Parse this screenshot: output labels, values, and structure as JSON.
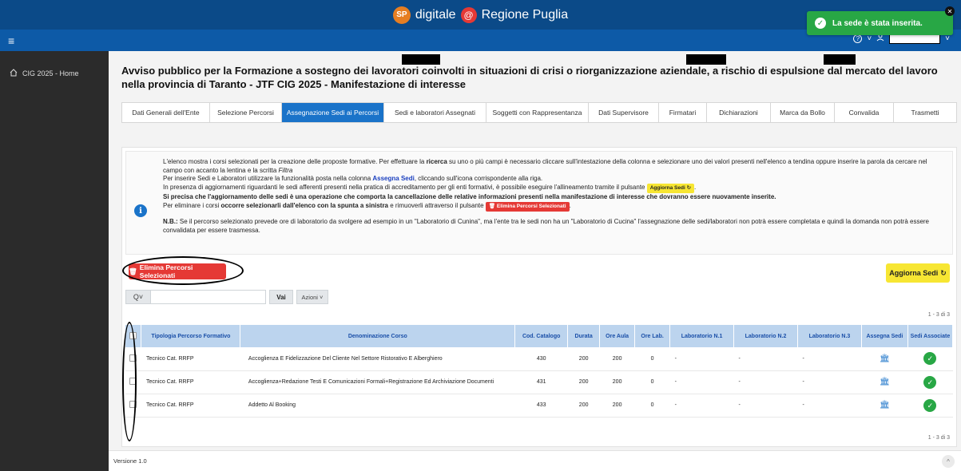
{
  "header": {
    "brand_badge": "SP",
    "brand_text_1": "digitale",
    "brand_at": "@",
    "brand_text_2": "Regione Puglia",
    "help_icon": "?",
    "chevron": "˅",
    "user_icon": "user-icon"
  },
  "toast": {
    "message": "La sede è stata inserita.",
    "check": "✓",
    "close": "✕"
  },
  "sidebar": {
    "items": [
      {
        "icon": "home-icon",
        "label": "CIG 2025 - Home"
      }
    ]
  },
  "page": {
    "title": "Avviso pubblico per la Formazione a sostegno dei lavoratori coinvolti in situazioni di crisi o riorganizzazione aziendale, a rischio di espulsione dal mercato del lavoro nella provincia di Taranto - JTF CIG 2025 - Manifestazione di interesse"
  },
  "tabs": [
    {
      "label": "Dati Generali dell'Ente",
      "active": false
    },
    {
      "label": "Selezione Percorsi",
      "active": false
    },
    {
      "label": "Assegnazione Sedi ai Percorsi",
      "active": true
    },
    {
      "label": "Sedi e laboratori Assegnati",
      "active": false
    },
    {
      "label": "Soggetti con Rappresentanza",
      "active": false
    },
    {
      "label": "Dati Supervisore",
      "active": false
    },
    {
      "label": "Firmatari",
      "active": false
    },
    {
      "label": "Dichiarazioni",
      "active": false
    },
    {
      "label": "Marca da Bollo",
      "active": false
    },
    {
      "label": "Convalida",
      "active": false
    },
    {
      "label": "Trasmetti",
      "active": false
    }
  ],
  "info": {
    "icon_letter": "i",
    "p1_a": "L'elenco mostra i corsi selezionati per la creazione delle proposte formative. Per effettuare la ",
    "p1_kw": "ricerca",
    "p1_b": " su uno o più campi è necessario cliccare sull'intestazione della colonna e selezionare uno dei valori presenti nell'elenco a tendina oppure inserire la parola da cercare nel campo con accanto la lentina e la scritta ",
    "p1_filter": "Filtra",
    "p2_a": "Per inserire Sedi e Laboratori utilizzare la funzionalità posta nella colonna ",
    "p2_kw": "Assegna Sedi",
    "p2_b": ", cliccando sull'icona corrispondente alla riga.",
    "p3_a": "In presenza di aggiornamenti riguardanti le sedi afferenti presenti nella pratica di accreditamento per gli enti formativi, è possibile eseguire l'allineamento tramite il pulsante ",
    "p3_chip": "Aggiorna Sedi ↻",
    "p3_b": ".",
    "p4": "Si precisa che l'aggiornamento delle sedi è una operazione che comporta la cancellazione delle relative informazioni presenti nella manifestazione di interesse che dovranno essere nuovamente inserite.",
    "p5_a": "Per eliminare i corsi ",
    "p5_kw": "occorre selezionarli dall'elenco con la spunta a sinistra",
    "p5_b": " e rimuoverli attraverso il pulsante ",
    "p5_chip": "🗑 Elimina Percorsi Selezionati",
    "p5_c": ".",
    "nb_label": "N.B.:",
    "nb_text": " Se il percorso selezionato prevede ore di laboratorio da svolgere ad esempio in un \"Laboratorio di Cunina\", ma l'ente tra le sedi non ha un \"Laboratorio di Cucina\" l'assegnazione delle sedi/laboratori non potrà essere completata e quindi la domanda non potrà essere convalidata per essere trasmessa."
  },
  "actions": {
    "delete_label": "Elimina Percorsi Selezionati",
    "delete_icon": "🗑",
    "update_label": "Aggiorna Sedi",
    "update_icon": "↻"
  },
  "search": {
    "drop_label": "Q˅",
    "placeholder": "",
    "go_label": "Vai",
    "actions_label": "Azioni ˅"
  },
  "pagination": {
    "top": "1 - 3 di 3",
    "bottom": "1 - 3 di 3"
  },
  "table": {
    "headers": [
      "",
      "Tipologia Percorso Formativo",
      "Denominazione Corso",
      "Cod. Catalogo",
      "Durata",
      "Ore Aula",
      "Ore Lab.",
      "Laboratorio N.1",
      "Laboratorio N.2",
      "Laboratorio N.3",
      "Assegna Sedi",
      "Sedi Associate"
    ],
    "rows": [
      {
        "tipo": "Tecnico Cat. RRFP",
        "corso": "Accoglienza E Fidelizzazione Del Cliente Nel Settore Ristorativo E Alberghiero",
        "cod": "430",
        "durata": "200",
        "aula": "200",
        "lab": "0",
        "l1": "-",
        "l2": "-",
        "l3": "-"
      },
      {
        "tipo": "Tecnico Cat. RRFP",
        "corso": "Accoglienza+Redazione Testi E Comunicazioni Formali+Registrazione Ed Archiviazione Documenti",
        "cod": "431",
        "durata": "200",
        "aula": "200",
        "lab": "0",
        "l1": "-",
        "l2": "-",
        "l3": "-"
      },
      {
        "tipo": "Tecnico Cat. RRFP",
        "corso": "Addetto Al Booking",
        "cod": "433",
        "durata": "200",
        "aula": "200",
        "lab": "0",
        "l1": "-",
        "l2": "-",
        "l3": "-"
      }
    ],
    "assign_icon": "bank-icon",
    "associated_icon": "check-circle-icon"
  },
  "footer": {
    "version": "Versione 1.0",
    "scroll_icon": "^"
  },
  "colors": {
    "primary": "#1a73c9",
    "header": "#0b4a88",
    "danger": "#e53935",
    "warning": "#f7e633",
    "success": "#28a745"
  }
}
